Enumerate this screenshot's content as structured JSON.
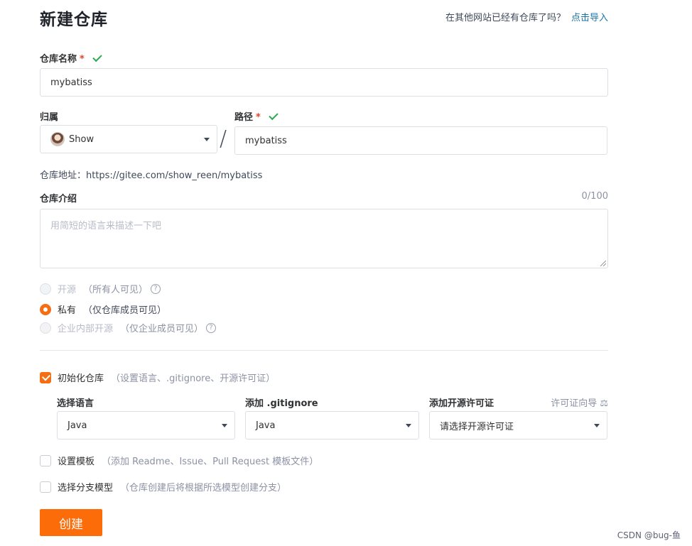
{
  "page": {
    "title": "新建仓库",
    "import_hint": "在其他网站已经有仓库了吗？",
    "import_link": "点击导入"
  },
  "repo_name": {
    "label": "仓库名称",
    "required_mark": "*",
    "value": "mybatiss"
  },
  "owner": {
    "label": "归属",
    "value": "Show"
  },
  "path": {
    "label": "路径",
    "required_mark": "*",
    "separator": "/",
    "value": "mybatiss"
  },
  "repo_address": "仓库地址：https://gitee.com/show_reen/mybatiss",
  "description": {
    "label": "仓库介绍",
    "counter": "0/100",
    "placeholder": "用简短的语言来描述一下吧"
  },
  "visibility": {
    "options": [
      {
        "label": "开源",
        "desc": "（所有人可见）",
        "selected": false,
        "disabled": true
      },
      {
        "label": "私有",
        "desc": "（仅仓库成员可见）",
        "selected": true,
        "disabled": false
      },
      {
        "label": "企业内部开源",
        "desc": "（仅企业成员可见）",
        "selected": false,
        "disabled": true
      }
    ],
    "help_glyph": "?"
  },
  "init_repo": {
    "checked": true,
    "label": "初始化仓库",
    "desc": "（设置语言、.gitignore、开源许可证）"
  },
  "language": {
    "label": "选择语言",
    "value": "Java"
  },
  "gitignore": {
    "label": "添加 .gitignore",
    "value": "Java"
  },
  "license": {
    "label": "添加开源许可证",
    "guide": "许可证向导",
    "guide_icon": "⚖",
    "value": "请选择开源许可证"
  },
  "template": {
    "checked": false,
    "label": "设置模板",
    "desc": "（添加 Readme、Issue、Pull Request 模板文件）"
  },
  "branch_model": {
    "checked": false,
    "label": "选择分支模型",
    "desc": "（仓库创建后将根据所选模型创建分支）"
  },
  "submit_label": "创建",
  "watermark": "CSDN @bug-鱼",
  "colors": {
    "accent": "#fc6d0a",
    "success": "#2fa84f",
    "required": "#e6422e",
    "link": "#1a73a8"
  }
}
